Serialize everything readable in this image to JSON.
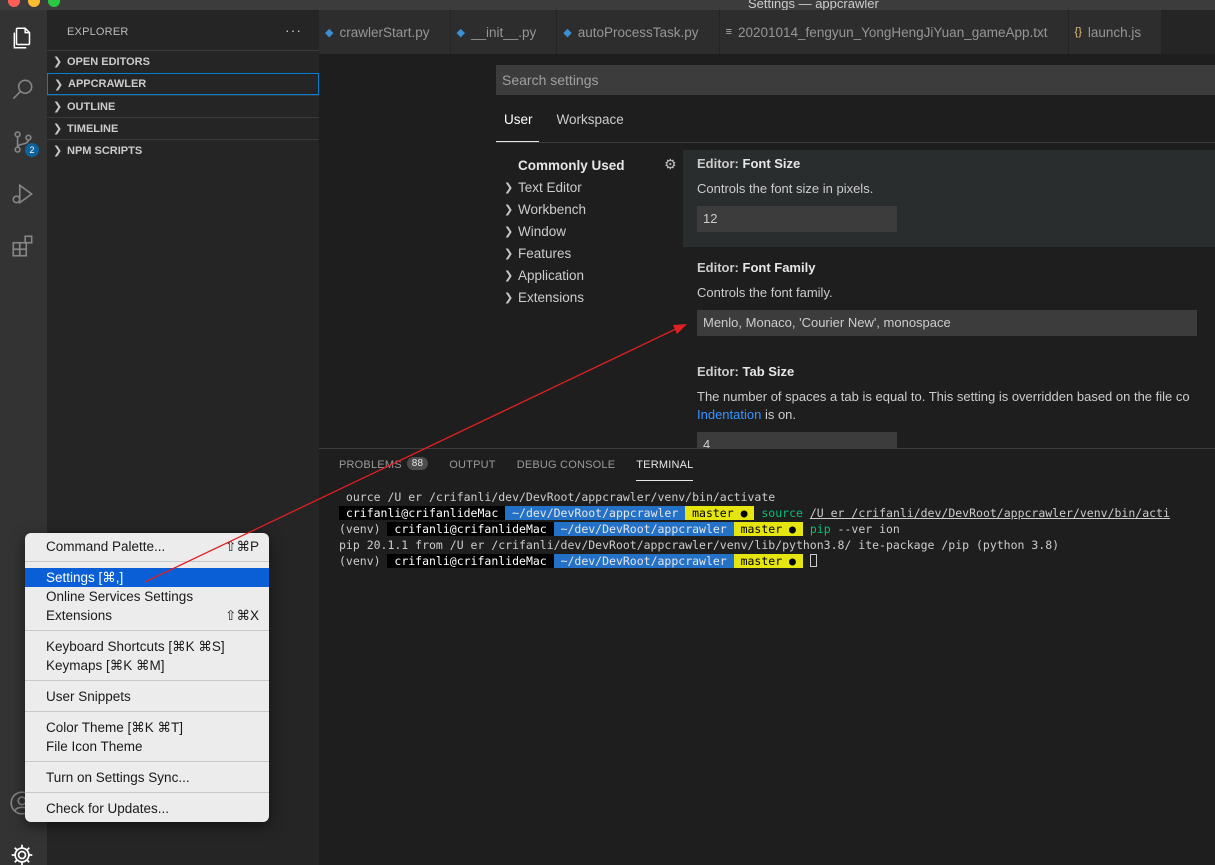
{
  "window": {
    "title": "Settings — appcrawler"
  },
  "activity_bar": {
    "scm_badge": "2"
  },
  "sidebar": {
    "title": "EXPLORER",
    "more": "···",
    "sections": [
      "OPEN EDITORS",
      "APPCRAWLER",
      "OUTLINE",
      "TIMELINE",
      "NPM SCRIPTS"
    ]
  },
  "tabs": [
    {
      "label": "crawlerStart.py",
      "icon": "python-file-icon"
    },
    {
      "label": "__init__.py",
      "icon": "python-file-icon"
    },
    {
      "label": "autoProcessTask.py",
      "icon": "python-file-icon"
    },
    {
      "label": "20201014_fengyun_YongHengJiYuan_gameApp.txt",
      "icon": "text-file-icon"
    },
    {
      "label": "launch.js",
      "icon": "json-file-icon"
    }
  ],
  "settings": {
    "search_placeholder": "Search settings",
    "scopes": [
      "User",
      "Workspace"
    ],
    "toc": [
      "Commonly Used",
      "Text Editor",
      "Workbench",
      "Window",
      "Features",
      "Application",
      "Extensions"
    ],
    "items": [
      {
        "category": "Editor: ",
        "name": "Font Size",
        "desc": "Controls the font size in pixels.",
        "value": "12"
      },
      {
        "category": "Editor: ",
        "name": "Font Family",
        "desc": "Controls the font family.",
        "value": "Menlo, Monaco, 'Courier New', monospace"
      },
      {
        "category": "Editor: ",
        "name": "Tab Size",
        "desc": "The number of spaces a tab is equal to. This setting is overridden based on the file co",
        "desc_link": "Indentation",
        "desc_tail": " is on.",
        "value": "4"
      }
    ]
  },
  "panel": {
    "tabs": [
      "PROBLEMS",
      "OUTPUT",
      "DEBUG CONSOLE",
      "TERMINAL"
    ],
    "problems_count": "88",
    "terminal": {
      "line1": " ource /U er /crifanli/dev/DevRoot/appcrawler/venv/bin/activate",
      "user": " crifanli@crifanlideMac ",
      "dir": " ~/dev/DevRoot/appcrawler ",
      "branch": " master ● ",
      "cmd_source": "source",
      "source_path": "/U er /crifanli/dev/DevRoot/appcrawler/venv/bin/acti",
      "venv": "(venv) ",
      "user2": " crifanli@crifanlideMac ",
      "cmd_pip": "pip",
      "pip_args": " --ver ion",
      "line4": "pip 20.1.1 from /U er /crifanli/dev/DevRoot/appcrawler/venv/lib/python3.8/ ite-package /pip (python 3.8)"
    }
  },
  "menu": {
    "items": [
      {
        "label": "Command Palette...",
        "shortcut": "⇧⌘P"
      },
      {
        "label": "Settings [⌘,]",
        "shortcut": ""
      },
      {
        "label": "Online Services Settings",
        "shortcut": ""
      },
      {
        "label": "Extensions",
        "shortcut": "⇧⌘X"
      },
      {
        "label": "Keyboard Shortcuts [⌘K ⌘S]",
        "shortcut": ""
      },
      {
        "label": "Keymaps [⌘K ⌘M]",
        "shortcut": ""
      },
      {
        "label": "User Snippets",
        "shortcut": ""
      },
      {
        "label": "Color Theme [⌘K ⌘T]",
        "shortcut": ""
      },
      {
        "label": "File Icon Theme",
        "shortcut": ""
      },
      {
        "label": "Turn on Settings Sync...",
        "shortcut": ""
      },
      {
        "label": "Check for Updates...",
        "shortcut": ""
      }
    ]
  },
  "colors": {
    "accent": "#0a5fd6",
    "annotation_arrow": "#e02020",
    "link": "#3794ff"
  }
}
